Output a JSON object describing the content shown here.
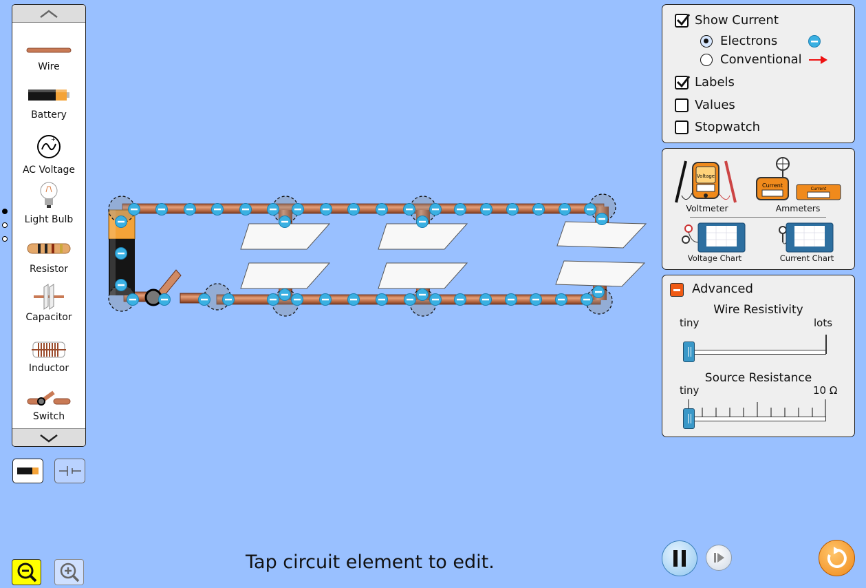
{
  "carousel": {
    "items": [
      {
        "label": "Wire",
        "icon": "wire-icon"
      },
      {
        "label": "Battery",
        "icon": "battery-icon"
      },
      {
        "label": "AC Voltage",
        "icon": "ac-voltage-icon"
      },
      {
        "label": "Light Bulb",
        "icon": "light-bulb-icon"
      },
      {
        "label": "Resistor",
        "icon": "resistor-icon"
      },
      {
        "label": "Capacitor",
        "icon": "capacitor-icon"
      },
      {
        "label": "Inductor",
        "icon": "inductor-icon"
      },
      {
        "label": "Switch",
        "icon": "switch-icon"
      }
    ],
    "pages": 3,
    "active_page": 1
  },
  "view_mode": {
    "lifelike": "battery-lifelike-icon",
    "schematic": "schematic-icon",
    "selected": "lifelike"
  },
  "display_options": {
    "show_current": {
      "label": "Show Current",
      "checked": true
    },
    "electrons": {
      "label": "Electrons",
      "selected": true
    },
    "conventional": {
      "label": "Conventional",
      "selected": false
    },
    "labels": {
      "label": "Labels",
      "checked": true
    },
    "values": {
      "label": "Values",
      "checked": false
    },
    "stopwatch": {
      "label": "Stopwatch",
      "checked": false
    }
  },
  "sensors": {
    "voltmeter": "Voltmeter",
    "ammeters": "Ammeters",
    "voltage_chart": "Voltage Chart",
    "current_chart": "Current Chart",
    "voltage_probe_text": "Voltage",
    "current_probe_text": "Current",
    "current_probe_text_small": "Current",
    "meter_readout": "—"
  },
  "advanced": {
    "title": "Advanced",
    "expanded": true,
    "wire_resistivity": {
      "title": "Wire Resistivity",
      "min_label": "tiny",
      "max_label": "lots",
      "value": 0
    },
    "source_resistance": {
      "title": "Source Resistance",
      "min_label": "tiny",
      "max_label": "10 Ω",
      "value": 0
    }
  },
  "hint": "Tap circuit element to edit.",
  "colors": {
    "background": "#99c0ff",
    "electron": "#3ab0e2",
    "wire": "#c97a55",
    "conventional_arrow": "#ee1111",
    "reset": "#f08a1c",
    "zoom_active": "#ffff00"
  }
}
